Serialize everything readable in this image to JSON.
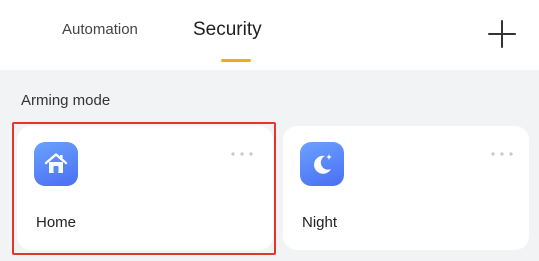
{
  "header": {
    "tabs": [
      {
        "label": "Automation",
        "active": false
      },
      {
        "label": "Security",
        "active": true
      }
    ],
    "accent_color": "#f5a623",
    "add_icon": "plus-icon"
  },
  "arming": {
    "section_title": "Arming mode",
    "modes": [
      {
        "label": "Home",
        "icon": "home-icon",
        "selected": true,
        "more_icon": "more-icon"
      },
      {
        "label": "Night",
        "icon": "moon-icon",
        "selected": false,
        "more_icon": "more-icon"
      }
    ],
    "selected_outline_color": "#e0362c"
  }
}
